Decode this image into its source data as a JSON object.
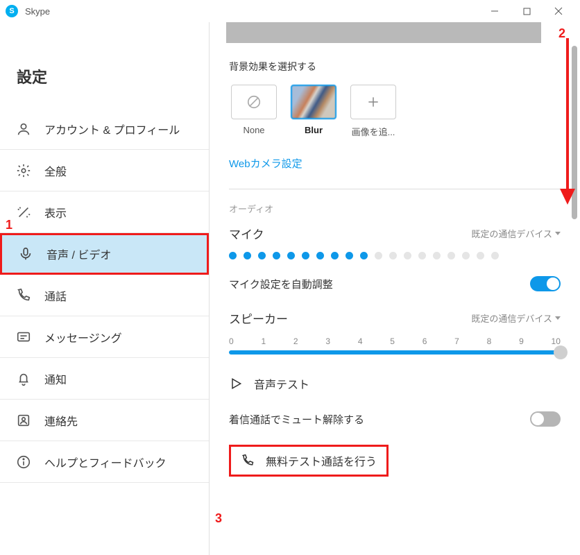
{
  "titlebar": {
    "app_name": "Skype"
  },
  "sidebar": {
    "title": "設定",
    "items": [
      {
        "label": "アカウント & プロフィール"
      },
      {
        "label": "全般"
      },
      {
        "label": "表示"
      },
      {
        "label": "音声 / ビデオ"
      },
      {
        "label": "通話"
      },
      {
        "label": "メッセージング"
      },
      {
        "label": "通知"
      },
      {
        "label": "連絡先"
      },
      {
        "label": "ヘルプとフィードバック"
      }
    ]
  },
  "content": {
    "background_effect_label": "背景効果を選択する",
    "bg_options": {
      "none": "None",
      "blur": "Blur",
      "add": "画像を追..."
    },
    "webcam_link": "Webカメラ設定",
    "audio_section": "オーディオ",
    "mic_label": "マイク",
    "default_device": "既定の通信デバイス",
    "auto_adjust_label": "マイク設定を自動調整",
    "speaker_label": "スピーカー",
    "slider_ticks": [
      "0",
      "1",
      "2",
      "3",
      "4",
      "5",
      "6",
      "7",
      "8",
      "9",
      "10"
    ],
    "audio_test": "音声テスト",
    "unmute_incoming": "着信通話でミュート解除する",
    "free_test_call": "無料テスト通話を行う",
    "mic_level_active": 10,
    "mic_level_total": 19,
    "auto_adjust_on": true,
    "unmute_on": false
  },
  "callouts": {
    "c1": "1",
    "c2": "2",
    "c3": "3"
  }
}
